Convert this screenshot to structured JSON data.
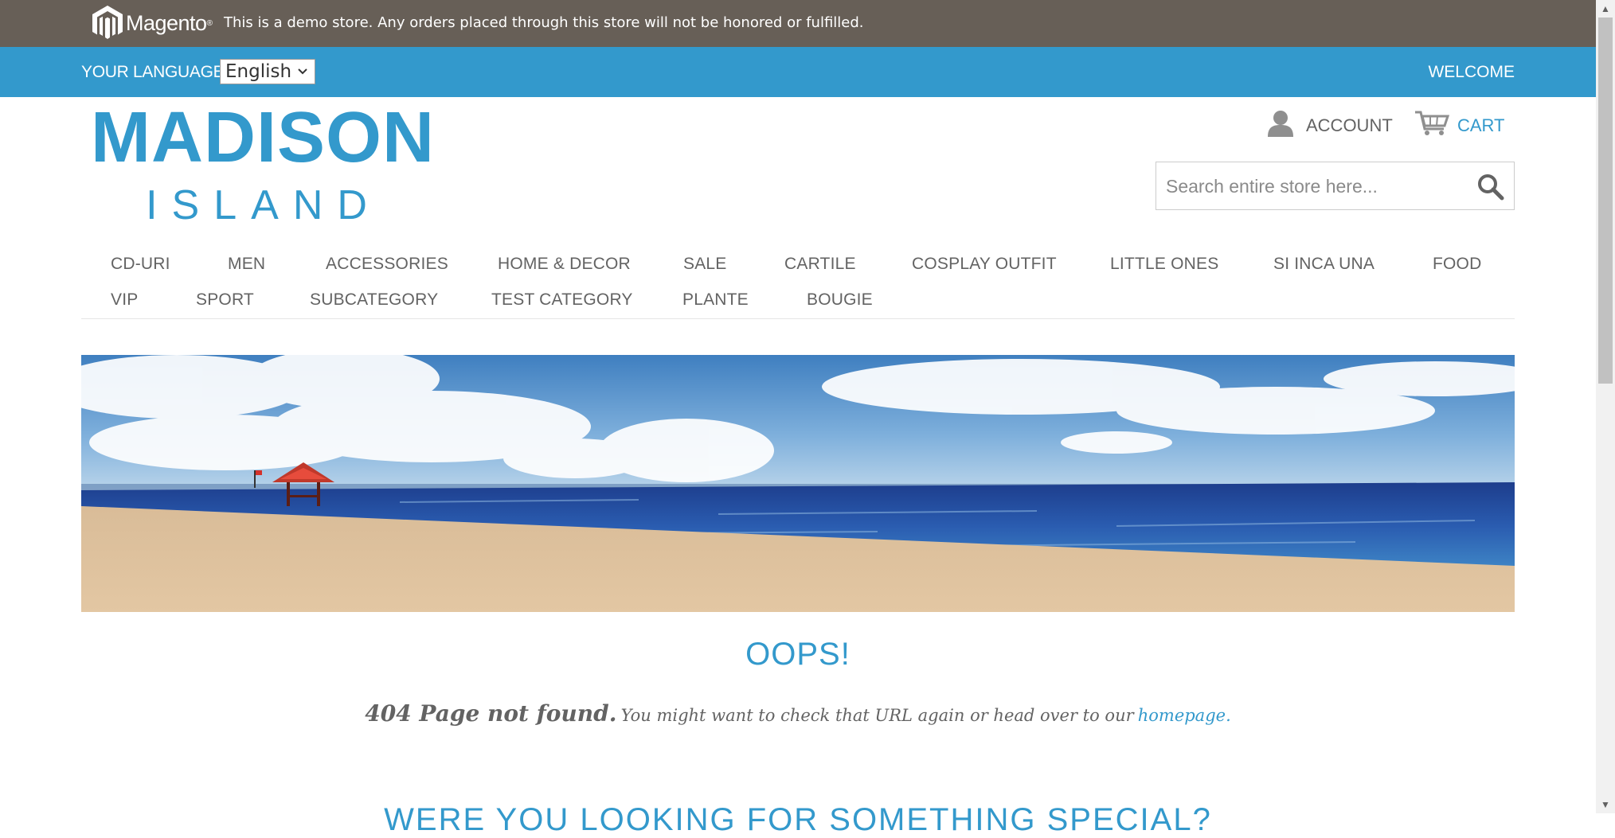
{
  "demo_notice": {
    "brand": "Magento",
    "text": "This is a demo store. Any orders placed through this store will not be honored or fulfilled."
  },
  "language_bar": {
    "label": "YOUR LANGUAGE:",
    "selected": "English",
    "welcome": "WELCOME"
  },
  "logo": {
    "line1": "MADISON",
    "line2": "ISLAND"
  },
  "header": {
    "account_label": "ACCOUNT",
    "cart_label": "CART",
    "search_placeholder": "Search entire store here..."
  },
  "nav": {
    "items": [
      "CD-URI",
      "MEN",
      "ACCESSORIES",
      "HOME & DECOR",
      "SALE",
      "CARTILE",
      "COSPLAY OUTFIT",
      "LITTLE ONES",
      "SI INCA UNA",
      "FOOD",
      "VIP",
      "SPORT",
      "SUBCATEGORY",
      "TEST CATEGORY",
      "PLANTE",
      "BOUGIE"
    ]
  },
  "error": {
    "title": "OOPS!",
    "headline": "404 Page not found.",
    "message": "You might want to check that URL again or head over to our",
    "link": "homepage.",
    "next_heading": "WERE YOU LOOKING FOR SOMETHING SPECIAL?"
  },
  "colors": {
    "accent": "#3399cc",
    "demo_bar": "#675f57",
    "text": "#636363"
  }
}
